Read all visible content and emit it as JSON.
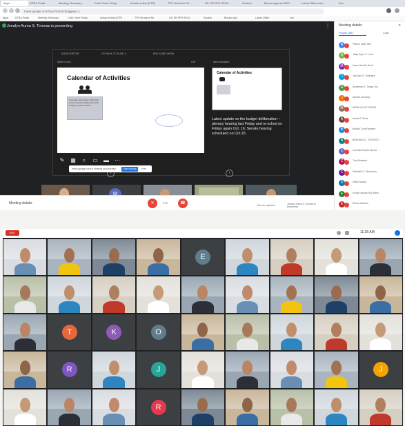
{
  "browser": {
    "tabs": [
      "Apps",
      "DTRA Portal",
      "Meeting: Summary",
      "Color Toner Setup",
      "Actual review (DTR)",
      "TPS Structure Re...",
      "OIL SR RPS SELD...",
      "Scratch",
      "Bid-aw-sign-as-2020",
      "Latest-Office-usin...",
      "Doc"
    ],
    "url": "meet.google.com/ncy-bcst-bxhq/gjpwr=1",
    "bookmarks": [
      "Apps",
      "DTRA Portal",
      "Meeting: Summary",
      "Color Toner Setup",
      "Actual review (DTR)",
      "TPS Structure Re",
      "OIL SR RPS SELD",
      "Scratch",
      "Bid-aw-sign",
      "Latest-Office",
      "Doc"
    ]
  },
  "meet": {
    "presenting": "Jenalyn Aurea S. Tinonas is presenting",
    "share_controls": [
      "SLIDE SORTER",
      "GO BACK TO SLIDE 4",
      "END SLIDE SHOW"
    ],
    "slide_counter": "Slide 5 of 18",
    "timer": "0:07",
    "next_label": "Next animation",
    "slide_title": "Calendar of Activities",
    "slide_card": "November-December 2020 Start of the schedule deliberation with budget proposal details",
    "thumb_title": "Calendar of Activities",
    "notes": "Latest update on the budget deliberation – plenary hearing last Friday and re-sched on Friday again Oct. 16; Senate hearing scheduled on Oct.20.",
    "stop_chip_text": "meet.google.com is sharing your screen",
    "stop_label": "Stop sharing",
    "hide_label": "Hide",
    "strip_names": [
      "Jenalyn Aurea S. Tin",
      "Rodelio B. Villanueva",
      "Rosalia F. Cruz",
      "Francis C. Sauro",
      "Lea Victoria F. Santos"
    ],
    "meeting_details": "Meeting details",
    "bar_count": "473",
    "turn_on_captions": "Turn on captions",
    "presenter_tag": "Jenalyn Aurea S. Tinonas is presenting"
  },
  "people_panel": {
    "title": "Meeting details",
    "people_label": "People (65)",
    "chat_label": "Chat",
    "entries": [
      {
        "initial": "R",
        "name": "Patrice Jade Tam",
        "color": "#4285f4"
      },
      {
        "initial": "A",
        "name": "Jalay Eyen C. Luna",
        "color": "#7cb342"
      },
      {
        "initial": "M",
        "name": "Iswar Gandhi Scott",
        "color": "#8e24aa"
      },
      {
        "initial": "J",
        "name": "Jay-Arp M. Tubangui",
        "color": "#039be5"
      },
      {
        "initial": "A",
        "name": "Ardemisa G. Tonga Cuz",
        "color": "#43a047"
      },
      {
        "initial": "J",
        "name": "Amelia Sunt Ayo",
        "color": "#ef6c00"
      },
      {
        "initial": "M",
        "name": "APRILYN M.T. BOSOL",
        "color": "#8d6e63"
      },
      {
        "initial": "A",
        "name": "Arelia R. Bonz",
        "color": "#6d4c41"
      },
      {
        "initial": "B",
        "name": "Bondio Cruz Ramirez",
        "color": "#1e88e5"
      },
      {
        "initial": "B",
        "name": "BERNADO L. TOLENTO",
        "color": "#00897b"
      },
      {
        "initial": "C",
        "name": "Carmela Reyes Bonos",
        "color": "#5c6bc0"
      },
      {
        "initial": "C",
        "name": "Tina Monteris",
        "color": "#ad1457"
      },
      {
        "initial": "C",
        "name": "Elisabeth C. Buenauro",
        "color": "#6a1b9a"
      },
      {
        "initial": "D",
        "name": "Daisy Manza",
        "color": "#0277bd"
      },
      {
        "initial": "E",
        "name": "Evelyn Banda Roy Marn",
        "color": "#2e7d32"
      },
      {
        "initial": "E",
        "name": "Elmira Sulanto",
        "color": "#c62828"
      }
    ]
  },
  "bottom_call": {
    "rec_label": "REC",
    "clock": "11:26 AM",
    "avatars": [
      "E",
      "T",
      "K",
      "O",
      "R",
      "J",
      "R",
      "J"
    ]
  }
}
